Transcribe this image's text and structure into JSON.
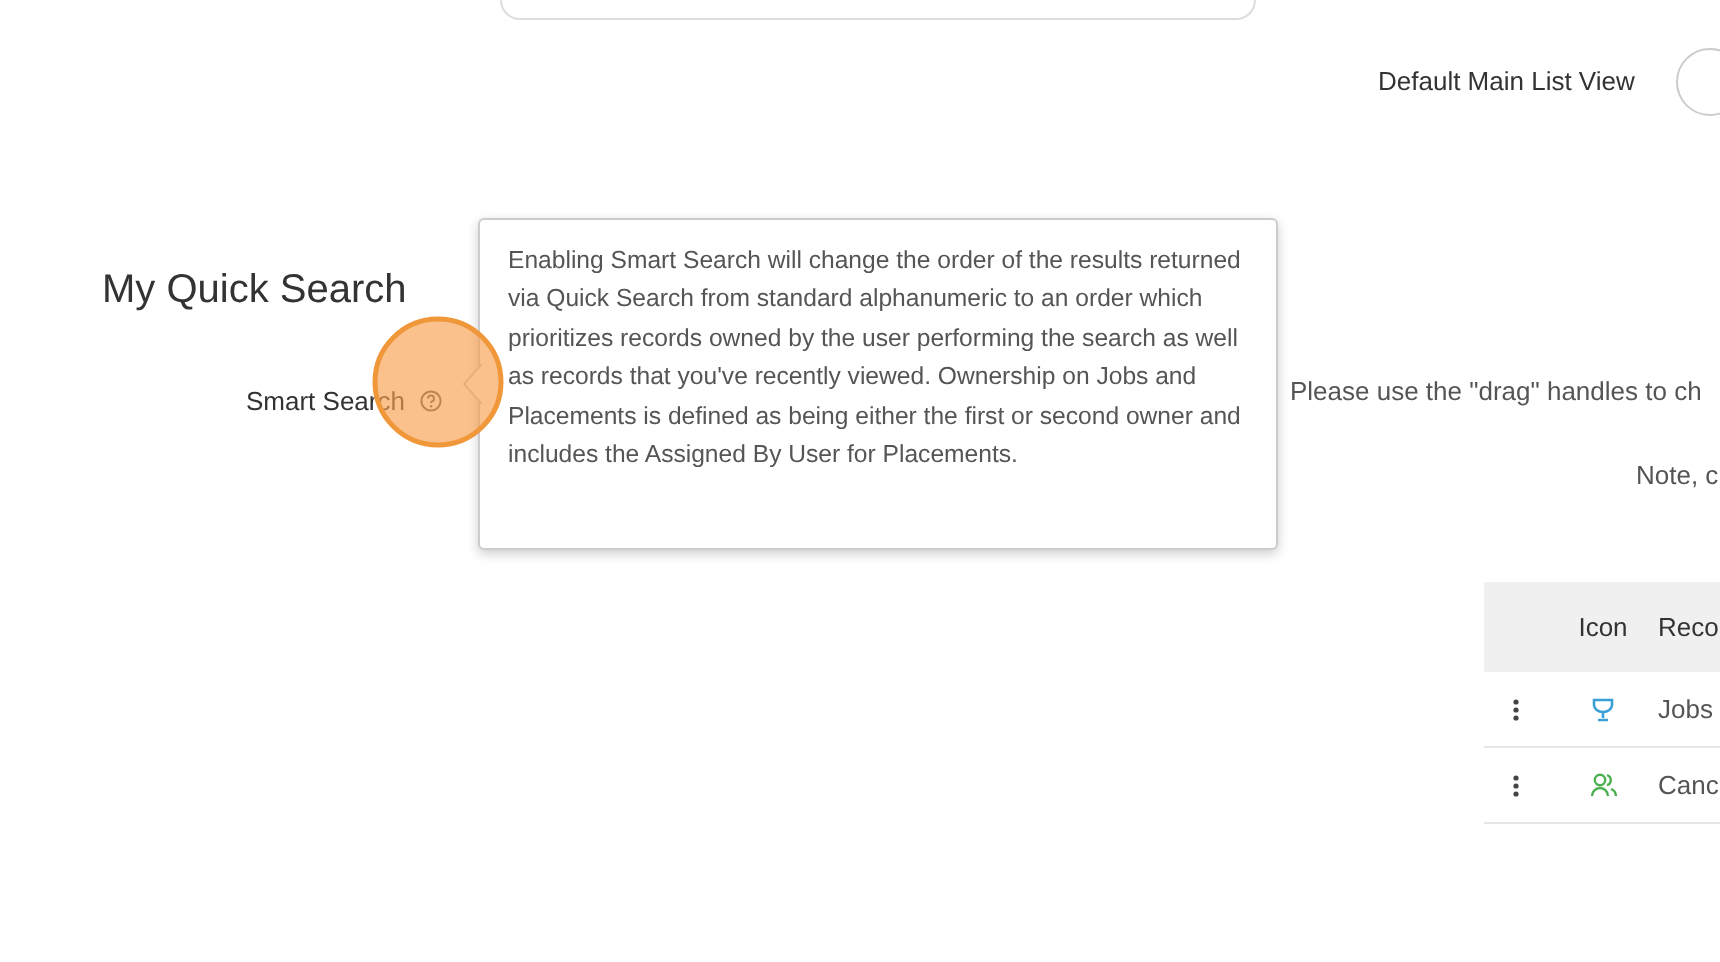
{
  "header": {
    "default_view_label": "Default Main List View"
  },
  "section": {
    "title": "My Quick Search",
    "smart_search": {
      "label": "Smart Search",
      "tooltip": "Enabling Smart Search will change the order of the results returned via Quick Search from standard alphanumeric to an order which prioritizes records owned by the user performing the search as well as records that you've recently viewed. Ownership on Jobs and Placements is defined as being either the first or second owner and includes the Assigned By User for Placements."
    },
    "instructions": "Please use the \"drag\" handles to ch",
    "note": "Note, c"
  },
  "table": {
    "columns": [
      "Icon",
      "Reco"
    ],
    "rows": [
      {
        "kind": "job",
        "label": "Jobs"
      },
      {
        "kind": "candidate",
        "label": "Canc"
      }
    ]
  }
}
